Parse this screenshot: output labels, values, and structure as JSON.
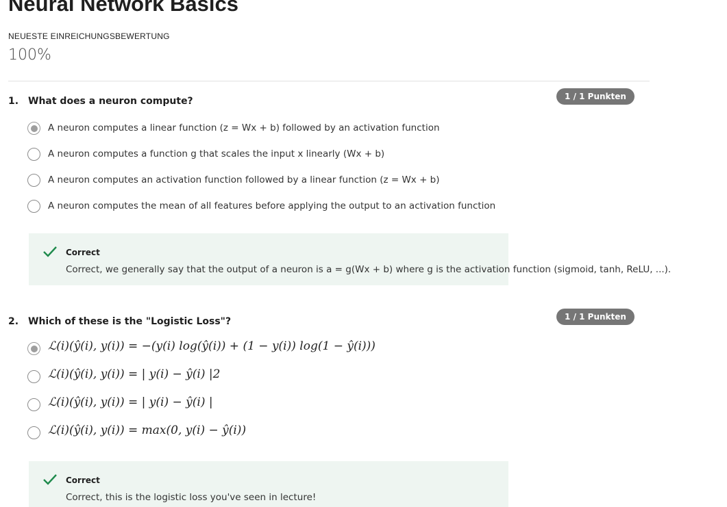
{
  "header": {
    "title": "Neural Network Basics",
    "grade_label": "NEUESTE EINREICHUNGSBEWERTUNG",
    "grade_value": "100%"
  },
  "questions": [
    {
      "number": "1.",
      "text": "What does a neuron compute?",
      "points": "1 / 1 Punkten",
      "options": [
        {
          "text": "A neuron computes a linear function (z = Wx + b) followed by an activation function",
          "selected": true
        },
        {
          "text": "A neuron computes a function g that scales the input x linearly (Wx + b)",
          "selected": false
        },
        {
          "text": "A neuron computes an activation function followed by a linear function (z = Wx + b)",
          "selected": false
        },
        {
          "text": "A neuron computes the mean of all features before applying the output to an activation function",
          "selected": false
        }
      ],
      "feedback": {
        "title": "Correct",
        "text": "Correct, we generally say that the output of a neuron is a = g(Wx + b) where g is the activation function (sigmoid, tanh, ReLU, ...)."
      }
    },
    {
      "number": "2.",
      "text": "Which of these is the \"Logistic Loss\"?",
      "points": "1 / 1 Punkten",
      "options": [
        {
          "text": "ℒ(i)(ŷ(i), y(i)) = −(y(i) log(ŷ(i)) + (1 − y(i)) log(1 − ŷ(i)))",
          "selected": true
        },
        {
          "text": "ℒ(i)(ŷ(i), y(i)) = | y(i) − ŷ(i) |2",
          "selected": false
        },
        {
          "text": "ℒ(i)(ŷ(i), y(i)) = | y(i) − ŷ(i) |",
          "selected": false
        },
        {
          "text": "ℒ(i)(ŷ(i), y(i)) = max(0, y(i) − ŷ(i))",
          "selected": false
        }
      ],
      "feedback": {
        "title": "Correct",
        "text": "Correct, this is the logistic loss you've seen in lecture!"
      }
    }
  ],
  "colors": {
    "badge": "#767676",
    "feedback_bg": "#eef5f1",
    "check": "#1e8a4c"
  },
  "icons": {
    "feedback": "checkmark-icon"
  }
}
